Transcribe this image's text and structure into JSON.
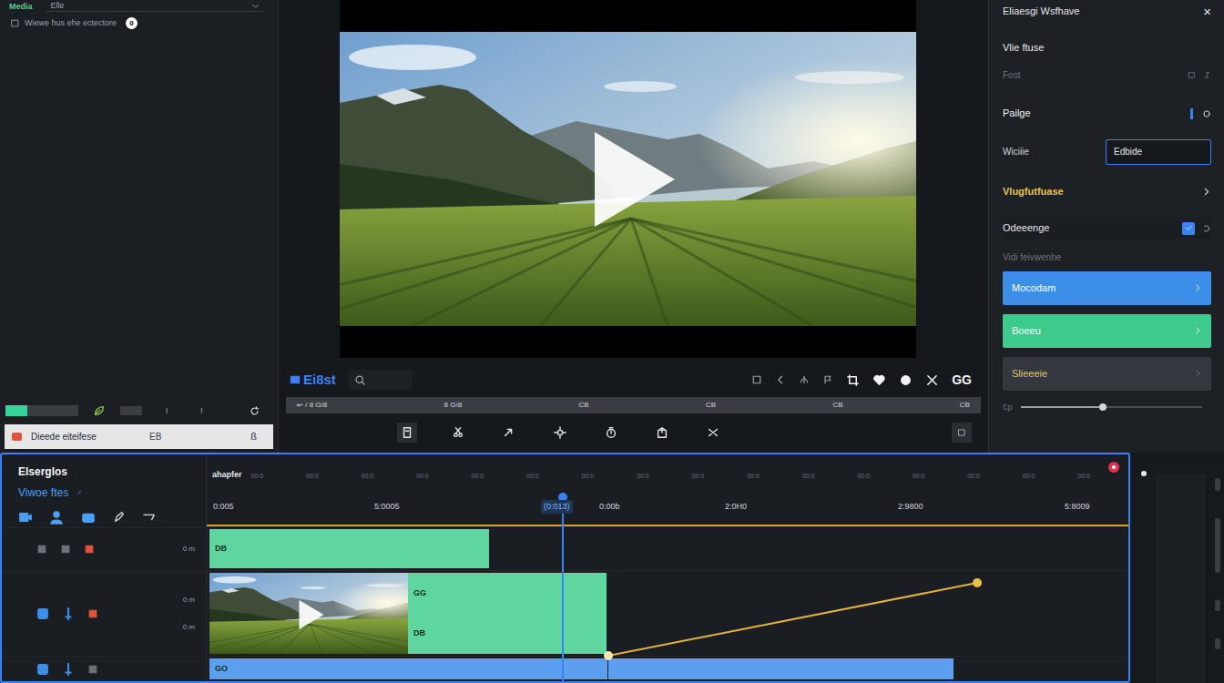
{
  "media_panel": {
    "title": "Media",
    "dropdown": "Elle",
    "hint": "Wiewe hus ehe ectectore",
    "hint_badge": "0",
    "meter": {
      "level": 0.3
    },
    "meter_marks": [
      "ι",
      "ι"
    ],
    "file": {
      "name": "Dieede eiteifese",
      "size": "EB",
      "tag": "ß"
    }
  },
  "preview": {
    "toolbar_label": "Ei8st",
    "toolbar_right": "GG",
    "scrubber_ticks": [
      "↜ / 8 G/8",
      "8 G/8",
      "CB",
      "CB",
      "CB",
      "CB"
    ]
  },
  "inspector": {
    "title": "Eliaesgi Wsfhave",
    "close": "×",
    "section": "Vlie ftuse",
    "font_label": "Fost",
    "page_label": "Pailge",
    "page_on": true,
    "width_label": "Wiciiie",
    "width_value": "Edbide",
    "group": "Vlugfutfuase",
    "group_expanded": false,
    "change_label": "Odeeenge",
    "change_checked": true,
    "note": "Vidi feivwenhe",
    "buttons": [
      {
        "label": "Mocodam",
        "color": "#3b8fe8"
      },
      {
        "label": "Boeeu",
        "color": "#3ec98d"
      },
      {
        "label": "Slieeeie",
        "color": "#34383e"
      }
    ],
    "slider": {
      "label": "Ɛp",
      "level": 0.45
    }
  },
  "timeline": {
    "title": "Elserglos",
    "subtitle": "Viwoe ftes",
    "ruler_label": "ahapfer",
    "ruler_ticks": [
      "00:0",
      "00:0",
      "00:0",
      "00:0",
      "00:0",
      "00:0",
      "00:0",
      "00:0",
      "00:0",
      "00:0",
      "00:0",
      "00:0",
      "00:0",
      "00:0",
      "00:0",
      "00:0"
    ],
    "times": [
      {
        "label": "0:005",
        "selected": false
      },
      {
        "label": "5:0005",
        "selected": false
      },
      {
        "label": "(0:013)",
        "selected": true
      },
      {
        "label": "0:00b",
        "selected": false
      },
      {
        "label": "2:0H0",
        "selected": false
      },
      {
        "label": "2:9800",
        "selected": false
      },
      {
        "label": "5:8009",
        "selected": false
      }
    ],
    "playhead": {
      "level": 0.389
    },
    "tracks": [
      {
        "values": [
          "0 m"
        ],
        "buttons": [
          {
            "kind": "lock",
            "on": false
          },
          {
            "kind": "eye",
            "on": false
          },
          {
            "kind": "rec",
            "on": true
          }
        ],
        "clips": [
          {
            "kind": "audio",
            "labels": [
              "DB"
            ],
            "color": "#5fd6a0"
          }
        ]
      },
      {
        "values": [
          "0 m",
          "0 m"
        ],
        "buttons": [
          {
            "kind": "film",
            "on": true
          },
          {
            "kind": "mic",
            "on": true
          },
          {
            "kind": "rec",
            "on": true
          }
        ],
        "clips": [
          {
            "kind": "video",
            "labels": []
          },
          {
            "kind": "audio",
            "labels": [
              "GG",
              "DB"
            ],
            "color": "#5fd6a0"
          }
        ]
      },
      {
        "values": [],
        "buttons": [
          {
            "kind": "film",
            "on": true
          },
          {
            "kind": "mic",
            "on": true
          },
          {
            "kind": "eye",
            "on": false
          }
        ],
        "clips": [
          {
            "kind": "audio",
            "labels": [
              "GO"
            ],
            "color": "#5ba0f0"
          },
          {
            "kind": "audio",
            "labels": [],
            "color": "#5ba0f0"
          }
        ]
      }
    ],
    "envelope": {
      "values": [
        0,
        1
      ]
    }
  }
}
